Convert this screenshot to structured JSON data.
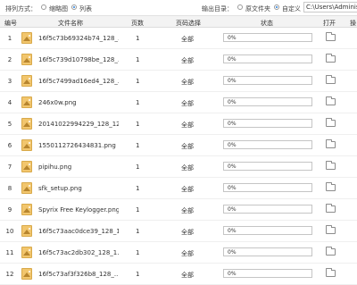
{
  "toolbar": {
    "arrange_label": "排列方式：",
    "view_thumbnail": "缩略图",
    "view_list": "列表",
    "selected_view": "列表",
    "output_dir_label": "输出目录：",
    "option_source_folder": "原文件夹",
    "option_custom": "自定义",
    "selected_output": "自定义",
    "output_path": "C:\\Users\\Administrator"
  },
  "table": {
    "headers": {
      "num": "编号",
      "name": "文件名称",
      "pages": "页数",
      "range": "页码选择",
      "status": "状态",
      "open": "打开",
      "op": "操"
    },
    "rows": [
      {
        "num": "1",
        "name": "16f5c73b69324b74_128_...",
        "pages": "1",
        "range": "全部",
        "progress_pct": "0%",
        "progress_value": 0
      },
      {
        "num": "2",
        "name": "16f5c739d10798be_128_...",
        "pages": "1",
        "range": "全部",
        "progress_pct": "0%",
        "progress_value": 0
      },
      {
        "num": "3",
        "name": "16f5c7499ad16ed4_128_...",
        "pages": "1",
        "range": "全部",
        "progress_pct": "0%",
        "progress_value": 0
      },
      {
        "num": "4",
        "name": "246x0w.png",
        "pages": "1",
        "range": "全部",
        "progress_pct": "0%",
        "progress_value": 0
      },
      {
        "num": "5",
        "name": "20141022994229_128_128...",
        "pages": "1",
        "range": "全部",
        "progress_pct": "0%",
        "progress_value": 0
      },
      {
        "num": "6",
        "name": "1550112726434831.png",
        "pages": "1",
        "range": "全部",
        "progress_pct": "0%",
        "progress_value": 0
      },
      {
        "num": "7",
        "name": "pipihu.png",
        "pages": "1",
        "range": "全部",
        "progress_pct": "0%",
        "progress_value": 0
      },
      {
        "num": "8",
        "name": "sfk_setup.png",
        "pages": "1",
        "range": "全部",
        "progress_pct": "0%",
        "progress_value": 0
      },
      {
        "num": "9",
        "name": "Spyrix Free Keylogger.png",
        "pages": "1",
        "range": "全部",
        "progress_pct": "0%",
        "progress_value": 0
      },
      {
        "num": "10",
        "name": "16f5c73aac0dce39_128_1...",
        "pages": "1",
        "range": "全部",
        "progress_pct": "0%",
        "progress_value": 0
      },
      {
        "num": "11",
        "name": "16f5c73ac2db302_128_1...",
        "pages": "1",
        "range": "全部",
        "progress_pct": "0%",
        "progress_value": 0
      },
      {
        "num": "12",
        "name": "16f5c73af3f326b8_128_...",
        "pages": "1",
        "range": "全部",
        "progress_pct": "0%",
        "progress_value": 0
      }
    ]
  },
  "colors": {
    "accent": "#2b7fd8",
    "progress_fill": "#5aa0e6"
  }
}
